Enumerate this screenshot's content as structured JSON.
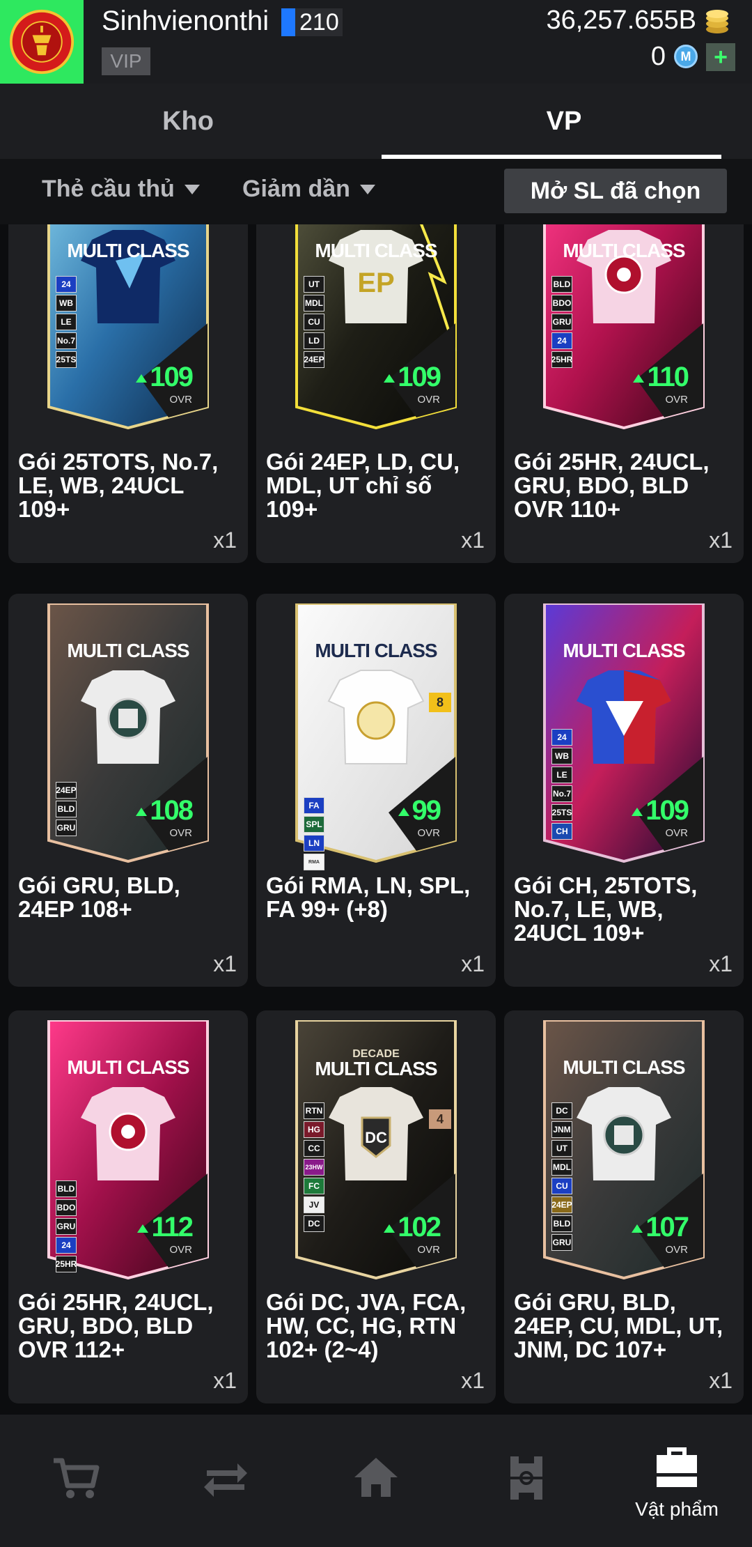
{
  "header": {
    "username": "Sinhvienonthi",
    "level": "210",
    "vip": "VIP",
    "coins": "36,257.655B",
    "mcoin": "0",
    "club_logo_text": "MANCHESTER UNITED",
    "add_label": "+"
  },
  "tabs": [
    {
      "label": "Kho",
      "active": false
    },
    {
      "label": "VP",
      "active": true
    }
  ],
  "filters": {
    "type": "Thẻ cầu thủ",
    "sort": "Giảm dần",
    "open_selected": "Mở SL đã chọn"
  },
  "items": [
    {
      "name": "Gói 25TOTS, No.7, LE, WB, 24UCL 109+",
      "qty": "x1",
      "card_label": "MULTI CLASS",
      "ovr": "109",
      "ovr_label": "OVR",
      "tags": [
        "24",
        "WB",
        "LE",
        "No.7",
        "25TS"
      ]
    },
    {
      "name": "Gói 24EP, LD, CU, MDL, UT chỉ số 109+",
      "qty": "x1",
      "card_label": "MULTI CLASS",
      "ovr": "109",
      "ovr_label": "OVR",
      "tags": [
        "UT",
        "MDL",
        "CU",
        "LD",
        "24EP"
      ]
    },
    {
      "name": "Gói 25HR, 24UCL, GRU, BDO, BLD OVR 110+",
      "qty": "x1",
      "card_label": "MULTI CLASS",
      "ovr": "110",
      "ovr_label": "OVR",
      "tags": [
        "BLD",
        "BDO",
        "GRU",
        "24",
        "25HR"
      ]
    },
    {
      "name": "Gói GRU, BLD, 24EP 108+",
      "qty": "x1",
      "card_label": "MULTI CLASS",
      "ovr": "108",
      "ovr_label": "OVR",
      "tags": [
        "24EP",
        "BLD",
        "GRU"
      ]
    },
    {
      "name": "Gói RMA, LN, SPL, FA 99+ (+8)",
      "qty": "x1",
      "card_label": "MULTI CLASS",
      "ovr": "99",
      "ovr_label": "OVR",
      "tags": [
        "FA",
        "SPL",
        "LN",
        "RMA"
      ],
      "badge": "8"
    },
    {
      "name": "Gói CH, 25TOTS, No.7, LE, WB, 24UCL 109+",
      "qty": "x1",
      "card_label": "MULTI CLASS",
      "ovr": "109",
      "ovr_label": "OVR",
      "tags": [
        "24",
        "WB",
        "LE",
        "No.7",
        "25TS",
        "CH"
      ]
    },
    {
      "name": "Gói 25HR, 24UCL, GRU, BDO, BLD OVR 112+",
      "qty": "x1",
      "card_label": "MULTI CLASS",
      "ovr": "112",
      "ovr_label": "OVR",
      "tags": [
        "BLD",
        "BDO",
        "GRU",
        "24",
        "25HR"
      ]
    },
    {
      "name": "Gói DC, JVA, FCA, HW, CC, HG, RTN 102+ (2~4)",
      "qty": "x1",
      "card_label": "MULTI CLASS",
      "decade": "DECADE",
      "ovr": "102",
      "ovr_label": "OVR",
      "tags": [
        "RTN",
        "HG",
        "CC",
        "23HW",
        "FC",
        "JV",
        "DC"
      ],
      "badge": "4"
    },
    {
      "name": "Gói GRU, BLD, 24EP, CU, MDL, UT, JNM, DC 107+",
      "qty": "x1",
      "card_label": "MULTI CLASS",
      "ovr": "107",
      "ovr_label": "OVR",
      "tags": [
        "DC",
        "JNM",
        "UT",
        "MDL",
        "CU",
        "24EP",
        "BLD",
        "GRU"
      ]
    }
  ],
  "bottom_nav": [
    {
      "icon": "cart-icon",
      "label": ""
    },
    {
      "icon": "transfer-icon",
      "label": ""
    },
    {
      "icon": "home-icon",
      "label": ""
    },
    {
      "icon": "pitch-icon",
      "label": ""
    },
    {
      "icon": "bag-icon",
      "label": "Vật phẩm"
    }
  ],
  "colors": {
    "ovr_green": "#33ff6a",
    "logo_bg": "#2ee85f",
    "level_blue": "#1e78ff"
  }
}
